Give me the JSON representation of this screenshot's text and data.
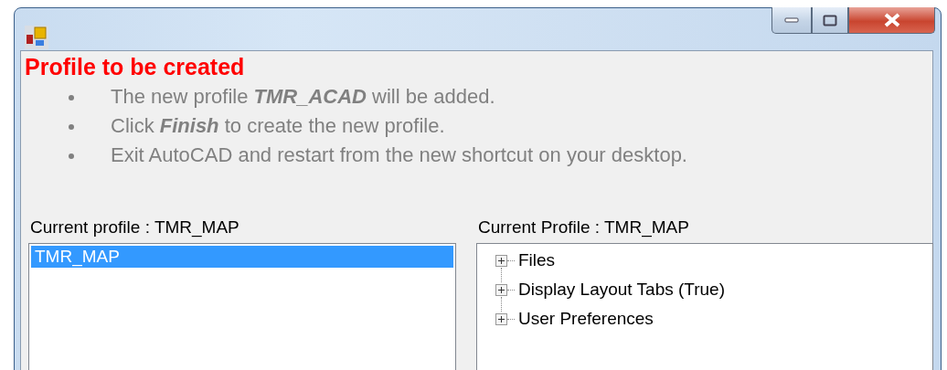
{
  "heading": "Profile to be created",
  "bullets": [
    "The new profile **TMR_ACAD** will be added.",
    "Click **Finish** to create the new profile.",
    "Exit AutoCAD and restart from the new shortcut on your desktop."
  ],
  "left": {
    "label": "Current profile : TMR_MAP",
    "items": [
      {
        "text": "TMR_MAP",
        "selected": true
      }
    ]
  },
  "right": {
    "label": "Current Profile : TMR_MAP",
    "tree": [
      {
        "text": "Files",
        "expanded": false
      },
      {
        "text": "Display Layout Tabs (True)",
        "expanded": false
      },
      {
        "text": "User Preferences",
        "expanded": false
      }
    ]
  }
}
